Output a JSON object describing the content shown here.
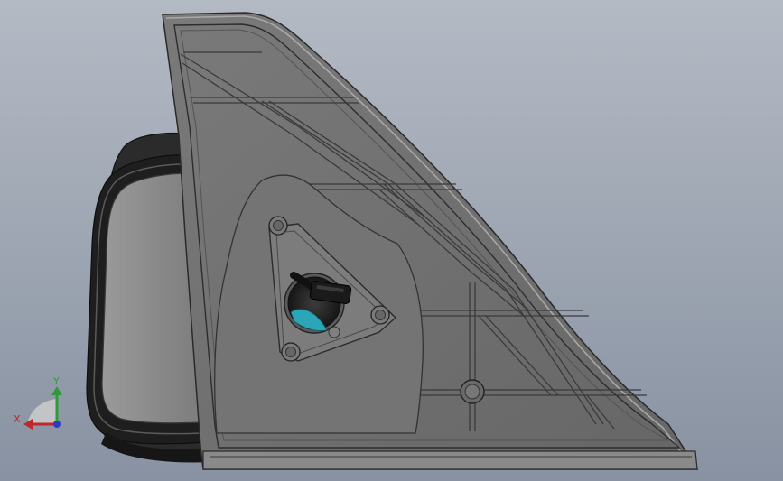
{
  "viewport": {
    "background_top": "#b4bac4",
    "background_bottom": "#8892a2"
  },
  "model": {
    "housing_color": "#6e6e6e",
    "housing_edge": "#2a2a2a",
    "mirror_glass_color": "#8a8a8a",
    "mirror_frame_color": "#1e1e1e",
    "connector_accent": "#2aa6b8"
  },
  "triad": {
    "x_label": "X",
    "y_label": "Y",
    "x_color": "#c0282c",
    "y_color": "#2e9a3a",
    "z_color": "#2b3fc2"
  }
}
